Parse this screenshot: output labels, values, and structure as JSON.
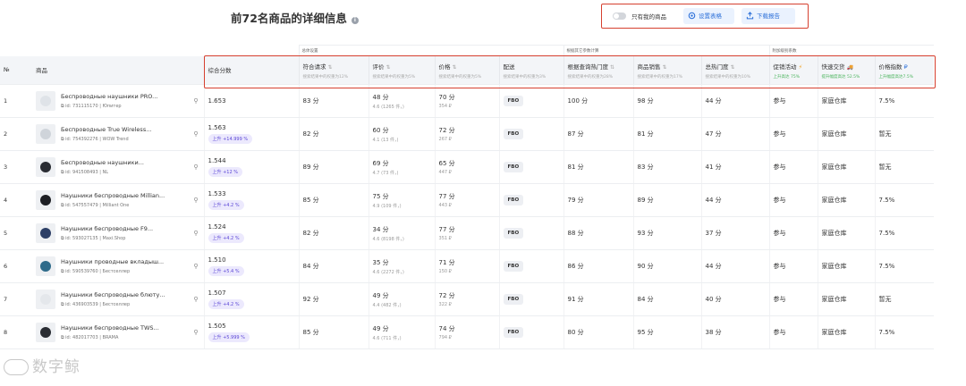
{
  "page": {
    "title": "前72名商品的详细信息",
    "info_icon": "i"
  },
  "toolbar": {
    "toggle_label": "只有我的商品",
    "settings_label": "设置表格",
    "download_label": "下载报告"
  },
  "groups": {
    "g1": "总体设置",
    "g2": "根据其它参数计算",
    "g3": "附加级别系数"
  },
  "columns": [
    {
      "title": "№",
      "sub": ""
    },
    {
      "title": "商品",
      "sub": ""
    },
    {
      "title": "综合分数",
      "sub": ""
    },
    {
      "title": "符合请求",
      "sub": "搜索结果中的权重为12%",
      "sort": "⇅"
    },
    {
      "title": "评价",
      "sub": "搜索结果中的权重为5%",
      "sort": "⇅"
    },
    {
      "title": "价格",
      "sub": "搜索结果中的权重为5%",
      "sort": "⇅"
    },
    {
      "title": "配送",
      "sub": "搜索结果中的权重为3%"
    },
    {
      "title": "根据查询热门度",
      "sub": "搜索结果中的权重为28%",
      "sort": "⇅"
    },
    {
      "title": "商品销售",
      "sub": "搜索结果中的权重为17%",
      "sort": "⇅"
    },
    {
      "title": "总热门度",
      "sub": "搜索结果中的权重为10%",
      "sort": "⇅"
    },
    {
      "title": "促销活动",
      "sub": "上升高达 75%",
      "icon": "⚡"
    },
    {
      "title": "快速交货",
      "sub": "提升幅度高达 52.5%",
      "icon": "🚚"
    },
    {
      "title": "价格指数",
      "sub": "上升幅度高达7.5%",
      "icon": "₽"
    }
  ],
  "rows": [
    {
      "n": "1",
      "name": "Беспроводные наушники PRO...",
      "id": "id: 731115170",
      "seller": "Юпитер",
      "score": "1.653",
      "trend": "",
      "req": "83 分",
      "rev": "48 分",
      "rev_sub": "4.6 (1265 件，)",
      "price": "70 分",
      "price_sub": "354 ₽",
      "del": "FBO",
      "qp": "100 分",
      "sales": "98 分",
      "pop": "44 分",
      "promo": "参与",
      "fast": "家庭仓库",
      "pidx": "7.5%",
      "thumb_color": "#dfe3e8"
    },
    {
      "n": "2",
      "name": "Беспроводные True Wireless...",
      "id": "id: 754392276",
      "seller": "WOW Trend",
      "score": "1.563",
      "trend": "上升 +14.999 %",
      "req": "82 分",
      "rev": "60 分",
      "rev_sub": "4.1 (13 件，)",
      "price": "72 分",
      "price_sub": "267 ₽",
      "del": "FBO",
      "qp": "87 分",
      "sales": "81 分",
      "pop": "47 分",
      "promo": "参与",
      "fast": "家庭仓库",
      "pidx": "暂无",
      "thumb_color": "#cfd4da"
    },
    {
      "n": "3",
      "name": "Беспроводные наушники...",
      "id": "id: 941508493",
      "seller": "NL",
      "score": "1.544",
      "trend": "上升 +12 %",
      "req": "89 分",
      "rev": "69 分",
      "rev_sub": "4.7 (73 件，)",
      "price": "65 分",
      "price_sub": "447 ₽",
      "del": "FBO",
      "qp": "81 分",
      "sales": "83 分",
      "pop": "41 分",
      "promo": "参与",
      "fast": "家庭仓库",
      "pidx": "暂无",
      "thumb_color": "#2a2d33"
    },
    {
      "n": "4",
      "name": "Наушники беспроводные Millian...",
      "id": "id: 547557479",
      "seller": "Milliant One",
      "score": "1.533",
      "trend": "上升 +4.2 %",
      "req": "85 分",
      "rev": "75 分",
      "rev_sub": "4.9 (109 件，)",
      "price": "77 分",
      "price_sub": "443 ₽",
      "del": "FBO",
      "qp": "79 分",
      "sales": "89 分",
      "pop": "44 分",
      "promo": "参与",
      "fast": "家庭仓库",
      "pidx": "7.5%",
      "thumb_color": "#1d1f24"
    },
    {
      "n": "5",
      "name": "Наушники беспроводные F9...",
      "id": "id: 593027135",
      "seller": "Maxi.Shop",
      "score": "1.524",
      "trend": "上升 +4.2 %",
      "req": "82 分",
      "rev": "34 分",
      "rev_sub": "4.6 (8198 件，)",
      "price": "77 分",
      "price_sub": "351 ₽",
      "del": "FBO",
      "qp": "88 分",
      "sales": "93 分",
      "pop": "37 分",
      "promo": "参与",
      "fast": "家庭仓库",
      "pidx": "7.5%",
      "thumb_color": "#2d3f66"
    },
    {
      "n": "6",
      "name": "Наушники проводные вкладыш...",
      "id": "id: 590539760",
      "seller": "Бестселлер",
      "score": "1.510",
      "trend": "上升 +5.4 %",
      "req": "84 分",
      "rev": "35 分",
      "rev_sub": "4.6 (2272 件，)",
      "price": "71 分",
      "price_sub": "150 ₽",
      "del": "FBO",
      "qp": "86 分",
      "sales": "90 分",
      "pop": "44 分",
      "promo": "参与",
      "fast": "家庭仓库",
      "pidx": "7.5%",
      "thumb_color": "#2f6b8a"
    },
    {
      "n": "7",
      "name": "Наушники беспроводные блюту...",
      "id": "id: 436903539",
      "seller": "Бестселлер",
      "score": "1.507",
      "trend": "上升 +4.2 %",
      "req": "92 分",
      "rev": "49 分",
      "rev_sub": "4.4 (482 件，)",
      "price": "72 分",
      "price_sub": "322 ₽",
      "del": "FBO",
      "qp": "91 分",
      "sales": "84 分",
      "pop": "40 分",
      "promo": "参与",
      "fast": "家庭仓库",
      "pidx": "暂无",
      "thumb_color": "#e4e7eb"
    },
    {
      "n": "8",
      "name": "Наушники беспроводные TWS...",
      "id": "id: 482017703",
      "seller": "BRAMA",
      "score": "1.505",
      "trend": "上升 +5.999 %",
      "req": "85 分",
      "rev": "49 分",
      "rev_sub": "4.6 (711 件，)",
      "price": "74 分",
      "price_sub": "794 ₽",
      "del": "FBO",
      "qp": "80 分",
      "sales": "95 分",
      "pop": "38 分",
      "promo": "参与",
      "fast": "家庭仓库",
      "pidx": "7.5%",
      "thumb_color": "#2a2d33"
    }
  ],
  "watermark": "数字鲸"
}
